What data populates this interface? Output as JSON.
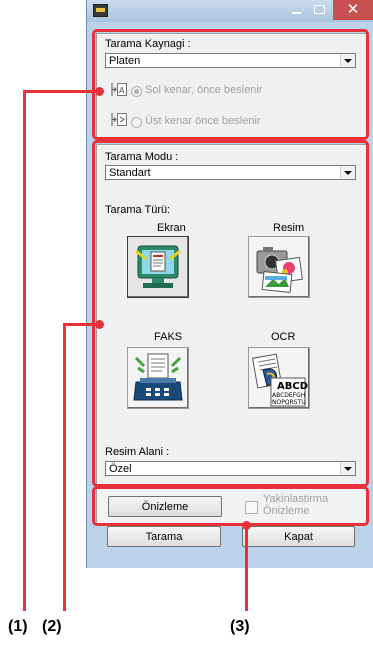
{
  "window": {
    "close_glyph": "✕"
  },
  "source_section": {
    "label": "Tarama Kaynagi :",
    "selected": "Platen",
    "option_left_edge": "Sol kenar, önce beslenir",
    "option_top_edge": "Üst kenar önce beslenir"
  },
  "mode_section": {
    "label": "Tarama Modu :",
    "selected": "Standart",
    "type_label": "Tarama Türü:",
    "types": [
      {
        "label": "Ekran",
        "icon": "monitor-document-icon",
        "selected": true
      },
      {
        "label": "Resim",
        "icon": "camera-photo-icon",
        "selected": false
      },
      {
        "label": "FAKS",
        "icon": "fax-machine-icon",
        "selected": false
      },
      {
        "label": "OCR",
        "icon": "ocr-document-icon",
        "selected": false
      }
    ],
    "ocr_icon_text": [
      "ABCD",
      "ABCDEFGH",
      "NOPQRSTU"
    ],
    "area_label": "Resim Alani :",
    "area_selected": "Özel"
  },
  "preview_section": {
    "preview_button": "Önizleme",
    "zoom_preview_line1": "Yakinlastirma",
    "zoom_preview_line2": "Önizleme"
  },
  "footer": {
    "scan_button": "Tarama",
    "close_button": "Kapat"
  },
  "callouts": {
    "c1": "(1)",
    "c2": "(2)",
    "c3": "(3)"
  },
  "colors": {
    "callout_red": "#e8303a",
    "window_frame": "#bcd2e8",
    "panel_bg": "#f0f0f0",
    "close_red": "#c75050"
  }
}
